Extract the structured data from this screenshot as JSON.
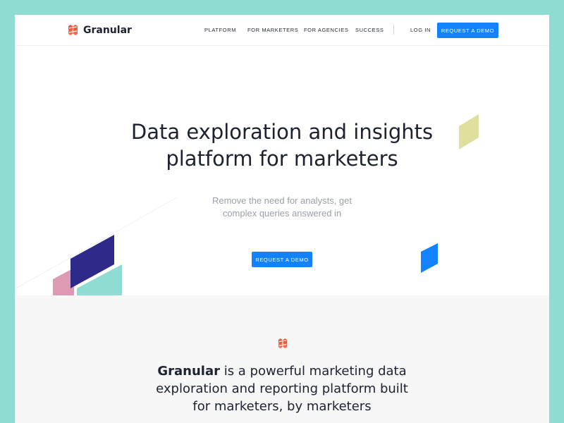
{
  "header": {
    "brand": "Granular",
    "nav": [
      {
        "id": "platform",
        "label": "PLATFORM"
      },
      {
        "id": "for-marketers",
        "label": "FOR MARKETERS"
      },
      {
        "id": "for-agencies",
        "label": "FOR AGENCIES"
      },
      {
        "id": "success",
        "label": "SUCCESS"
      },
      {
        "id": "log-in",
        "label": "LOG IN"
      }
    ],
    "cta_label": "REQUEST A DEMO"
  },
  "hero": {
    "title_line1": "Data exploration and insights",
    "title_line2": "platform for marketers",
    "subtitle_line1": "Remove the need for analysts, get",
    "subtitle_line2": "complex queries answered in",
    "cta_label": "REQUEST A DEMO"
  },
  "about": {
    "brand": "Granular",
    "text_line1_rest": " is a powerful marketing data",
    "text_line2": "exploration and reporting platform built",
    "text_line3": "for marketers, by marketers"
  },
  "colors": {
    "page_bg": "#8fdcd2",
    "accent_blue": "#1282ff",
    "brand_orange": "#f05a38",
    "navy": "#2e2a8a",
    "pink": "#dc9ab5",
    "teal": "#8fdcd2",
    "olive": "#dfe09c"
  },
  "icons": {
    "logo": "granular-logo-icon"
  }
}
